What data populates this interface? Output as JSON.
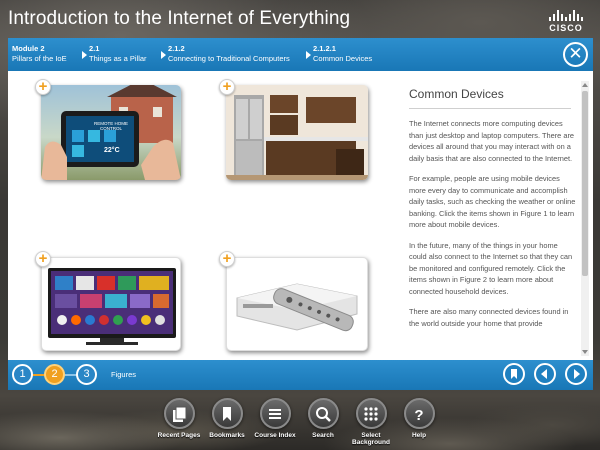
{
  "app": {
    "course_title": "Introduction to the Internet of Everything",
    "brand": "CISCO"
  },
  "breadcrumb": [
    {
      "num": "Module 2",
      "title": "Pillars of the IoE"
    },
    {
      "num": "2.1",
      "title": "Things as a Pillar"
    },
    {
      "num": "2.1.2",
      "title": "Connecting to Traditional Computers"
    },
    {
      "num": "2.1.2.1",
      "title": "Common Devices"
    }
  ],
  "figures": [
    {
      "icon": "tablet-home-control-image",
      "screen_title": "REMOTE HOME CONTROL",
      "temp": "22°C"
    },
    {
      "icon": "kitchen-appliances-image"
    },
    {
      "icon": "smart-tv-image"
    },
    {
      "icon": "set-top-box-remote-image"
    }
  ],
  "panel": {
    "title": "Common Devices",
    "paragraphs": [
      "The Internet connects more computing devices than just desktop and laptop computers. There are devices all around that you may interact with on a daily basis that are also connected to the Internet.",
      "For example, people are using mobile devices more every day to communicate and accomplish daily tasks, such as checking the weather or online banking. Click the items shown in Figure 1 to learn more about mobile devices.",
      "In the future, many of the things in your home could also connect to the Internet so that they can be monitored and configured remotely. Click the items shown in Figure 2 to learn more about connected household devices.",
      "There are also many connected devices found in the world outside your home that provide"
    ]
  },
  "pager": {
    "pages": [
      "1",
      "2",
      "3"
    ],
    "active_index": 1,
    "label": "Figures"
  },
  "dock": [
    {
      "label": "Recent Pages",
      "icon": "recent-pages-icon"
    },
    {
      "label": "Bookmarks",
      "icon": "bookmark-icon"
    },
    {
      "label": "Course Index",
      "icon": "course-index-icon"
    },
    {
      "label": "Search",
      "icon": "search-icon"
    },
    {
      "label": "Select Background",
      "icon": "select-background-icon"
    },
    {
      "label": "Help",
      "icon": "help-icon"
    }
  ],
  "colors": {
    "header_blue": "#1977b6",
    "accent_orange": "#f0a020"
  }
}
